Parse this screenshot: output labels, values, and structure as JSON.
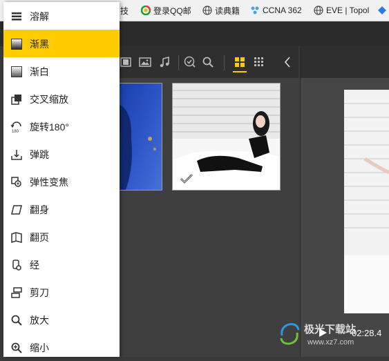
{
  "bookmarks": [
    {
      "label": "技",
      "icon": "page-icon"
    },
    {
      "label": "登录QQ邮",
      "icon": "qq-icon"
    },
    {
      "label": "读典籍",
      "icon": "globe-icon"
    },
    {
      "label": "CCNA 362",
      "icon": "ccna-icon"
    },
    {
      "label": "EVE | Topol",
      "icon": "globe-icon"
    }
  ],
  "menu": {
    "selected_index": 1,
    "items": [
      {
        "label": "溶解",
        "icon": "dissolve-icon"
      },
      {
        "label": "渐黑",
        "icon": "fade-black-icon"
      },
      {
        "label": "渐白",
        "icon": "fade-white-icon"
      },
      {
        "label": "交叉缩放",
        "icon": "cross-zoom-icon"
      },
      {
        "label": "旋转180°",
        "icon": "rotate-180-icon"
      },
      {
        "label": "弹跳",
        "icon": "bounce-icon"
      },
      {
        "label": "弹性变焦",
        "icon": "elastic-zoom-icon"
      },
      {
        "label": "翻身",
        "icon": "flip-over-icon"
      },
      {
        "label": "翻页",
        "icon": "page-turn-icon"
      },
      {
        "label": "经",
        "icon": "scroll-icon"
      },
      {
        "label": "剪刀",
        "icon": "scissors-icon"
      },
      {
        "label": "放大",
        "icon": "zoom-in-icon"
      },
      {
        "label": "缩小",
        "icon": "zoom-out-icon"
      }
    ]
  },
  "toolbar": {
    "icons": [
      "video-filter-icon",
      "image-filter-icon",
      "music-filter-icon",
      "check-filter-icon",
      "search-icon",
      "grid-large-icon",
      "grid-small-icon",
      "collapse-left-icon"
    ],
    "active": "grid-large-icon",
    "accent": "#ffcc00"
  },
  "preview": {
    "time": "02:28.4"
  },
  "watermark": "极光下载站",
  "watermark_url": "www.xz7.com"
}
